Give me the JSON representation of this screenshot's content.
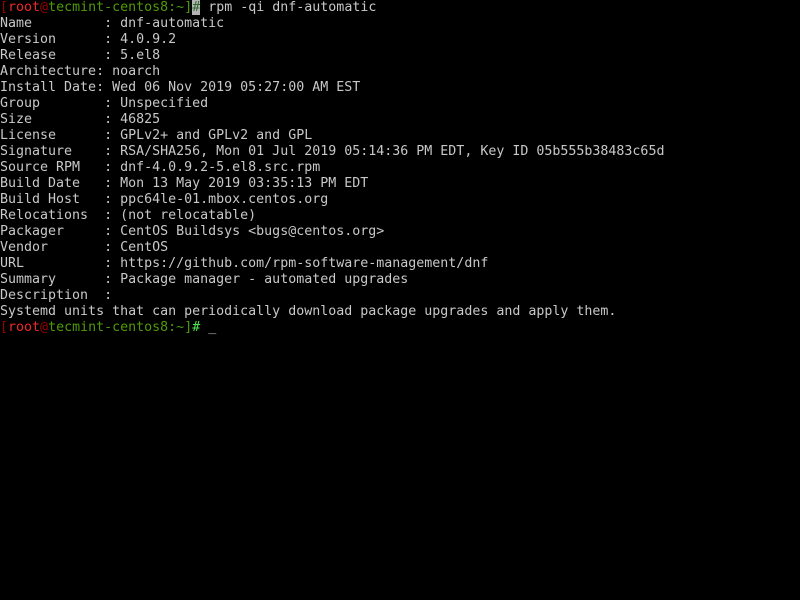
{
  "terminal": {
    "title": "Terminal",
    "colors": {
      "background": "#000000",
      "foreground": "#c8c8c8",
      "prompt_bracket": "#990000",
      "prompt_user": "#ef2929",
      "prompt_host": "#4e9a06",
      "prompt_hash": "#4ee44e",
      "cursor_block": "#b4b4b4"
    },
    "prompt": {
      "open_bracket": "[",
      "user": "root",
      "at": "@",
      "host": "tecmint-centos8",
      "colon": ":",
      "path": "~",
      "close_bracket": "]",
      "hash": "#"
    },
    "command_line": {
      "command": " rpm -qi dnf-automatic"
    },
    "cursor": "_",
    "output_lines": [
      "Name         : dnf-automatic",
      "Version      : 4.0.9.2",
      "Release      : 5.el8",
      "Architecture: noarch",
      "Install Date: Wed 06 Nov 2019 05:27:00 AM EST",
      "Group        : Unspecified",
      "Size         : 46825",
      "License      : GPLv2+ and GPLv2 and GPL",
      "Signature    : RSA/SHA256, Mon 01 Jul 2019 05:14:36 PM EDT, Key ID 05b555b38483c65d",
      "Source RPM   : dnf-4.0.9.2-5.el8.src.rpm",
      "Build Date   : Mon 13 May 2019 03:35:13 PM EDT",
      "Build Host   : ppc64le-01.mbox.centos.org",
      "Relocations  : (not relocatable)",
      "Packager     : CentOS Buildsys <bugs@centos.org>",
      "Vendor       : CentOS",
      "URL          : https://github.com/rpm-software-management/dnf",
      "Summary      : Package manager - automated upgrades",
      "Description  :",
      "Systemd units that can periodically download package upgrades and apply them."
    ]
  }
}
